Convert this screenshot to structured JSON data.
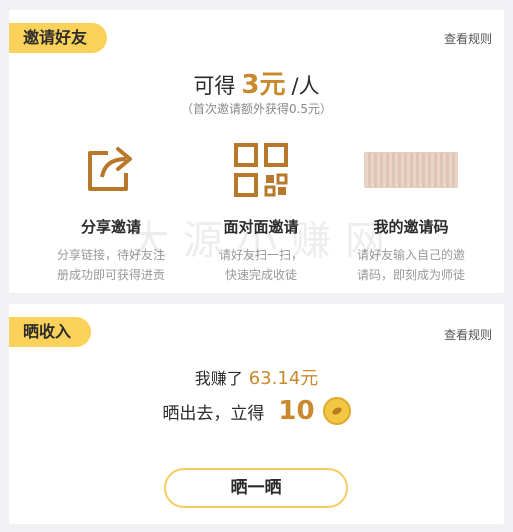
{
  "invite": {
    "title": "邀请好友",
    "rules_link": "查看规则",
    "earn": {
      "prefix": "可得",
      "amount": "3元",
      "suffix": "/人"
    },
    "note": "（首次邀请额外获得0.5元）",
    "options": [
      {
        "title": "分享邀请",
        "desc_line1": "分享链接，待好友注",
        "desc_line2": "册成功即可获得进贡",
        "icon": "share-icon"
      },
      {
        "title": "面对面邀请",
        "desc_line1": "请好友扫一扫，",
        "desc_line2": "快速完成收徒",
        "icon": "qr-code-icon"
      },
      {
        "title": "我的邀请码",
        "desc_line1": "请好友输入自己的邀",
        "desc_line2": "请码，即刻成为师徒",
        "icon": "invite-code-box"
      }
    ],
    "watermark": "大源小赚网"
  },
  "income": {
    "title": "晒收入",
    "rules_link": "查看规则",
    "earned_label": "我赚了",
    "earned_value": "63.14元",
    "share_label": "晒出去，立得",
    "share_reward": "10",
    "reward_icon": "gold-coin-icon",
    "button_label": "晒一晒"
  },
  "colors": {
    "accent": "#c9892c",
    "tag_bg": "#fbd259",
    "button_border": "#f3cd62"
  }
}
